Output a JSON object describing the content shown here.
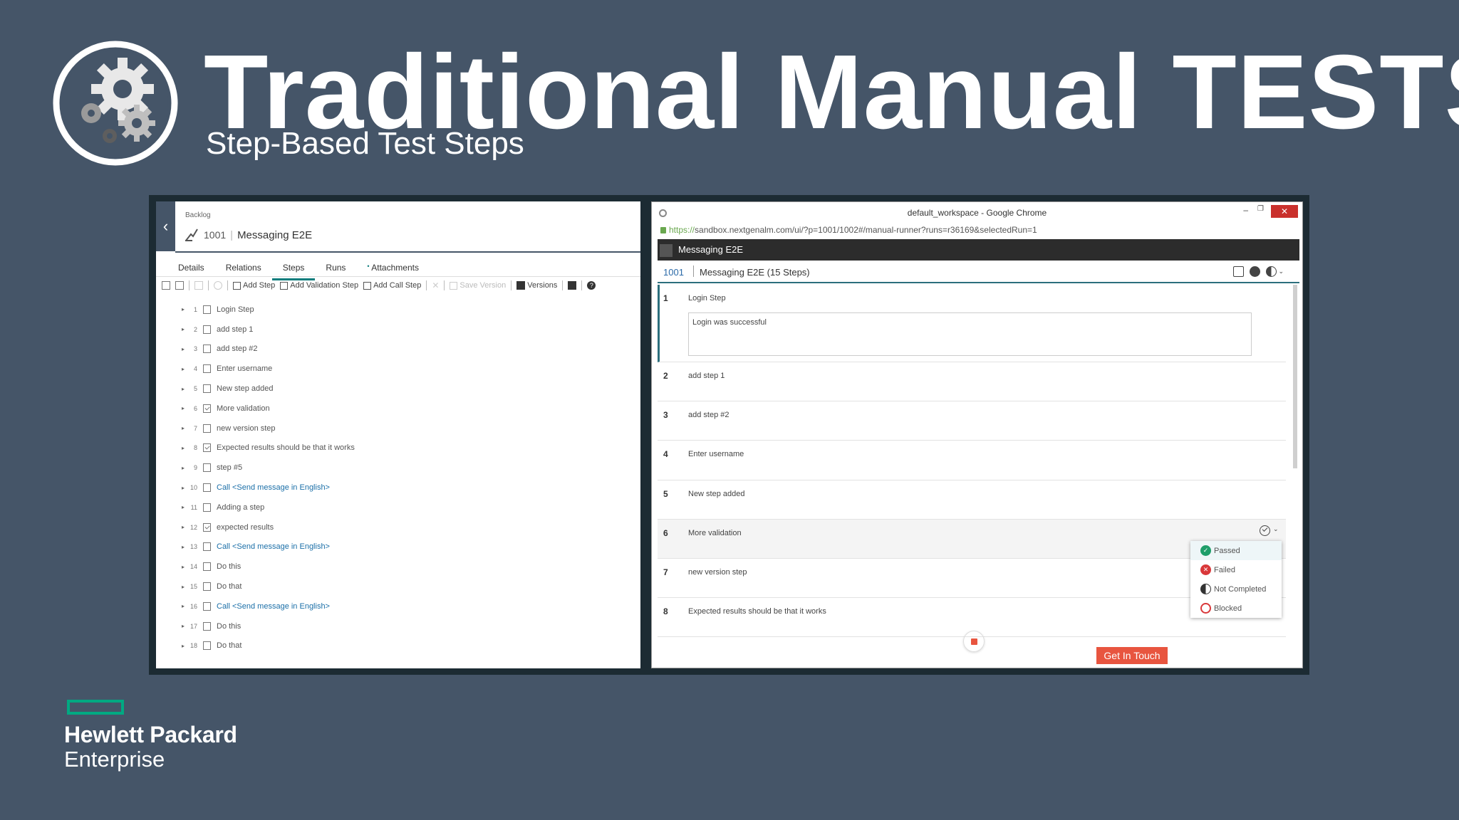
{
  "slide": {
    "title": "Traditional Manual TESTS",
    "subtitle": "Step-Based Test Steps",
    "logo_icon": "gears-icon"
  },
  "left_panel": {
    "breadcrumb": "Backlog",
    "entity_id": "1001",
    "entity_name": "Messaging E2E",
    "tabs": [
      {
        "label": "Details"
      },
      {
        "label": "Relations"
      },
      {
        "label": "Steps",
        "active": true
      },
      {
        "label": "Runs"
      },
      {
        "label": "Attachments",
        "dot": "•"
      }
    ],
    "toolbar": {
      "add_step": "Add Step",
      "add_validation_step": "Add Validation Step",
      "add_call_step": "Add Call Step",
      "save_version": "Save Version",
      "versions": "Versions",
      "help": "?"
    },
    "steps": [
      {
        "num": "1",
        "text": "Login Step",
        "type": "step"
      },
      {
        "num": "2",
        "text": "add step 1",
        "type": "step"
      },
      {
        "num": "3",
        "text": "add step #2",
        "type": "step"
      },
      {
        "num": "4",
        "text": "Enter username",
        "type": "step"
      },
      {
        "num": "5",
        "text": "New step added",
        "type": "step"
      },
      {
        "num": "6",
        "text": "More validation",
        "type": "validation"
      },
      {
        "num": "7",
        "text": "new version step",
        "type": "step"
      },
      {
        "num": "8",
        "text": "Expected results should be that it works",
        "type": "validation"
      },
      {
        "num": "9",
        "text": "step #5",
        "type": "step"
      },
      {
        "num": "10",
        "text": "Call <Send message in English>",
        "type": "call"
      },
      {
        "num": "11",
        "text": "Adding a step",
        "type": "step"
      },
      {
        "num": "12",
        "text": "expected results",
        "type": "validation"
      },
      {
        "num": "13",
        "text": "Call <Send message in English>",
        "type": "call"
      },
      {
        "num": "14",
        "text": "Do this",
        "type": "step"
      },
      {
        "num": "15",
        "text": "Do that",
        "type": "step"
      },
      {
        "num": "16",
        "text": "Call <Send message in English>",
        "type": "call"
      },
      {
        "num": "17",
        "text": "Do this",
        "type": "step"
      },
      {
        "num": "18",
        "text": "Do that",
        "type": "step"
      }
    ]
  },
  "right_panel": {
    "window_title": "default_workspace - Google Chrome",
    "window_controls": {
      "minimize": "–",
      "maximize": "❐",
      "close": "✕"
    },
    "url_scheme": "https://",
    "url_rest": "sandbox.nextgenalm.com/ui/?p=1001/1002#/manual-runner?runs=r36169&selectedRun=1",
    "run_title": "Messaging E2E",
    "run_id": "1001",
    "run_name": "Messaging E2E (15 Steps)",
    "steps": [
      {
        "num": "1",
        "text": "Login Step",
        "result": "Login was successful"
      },
      {
        "num": "2",
        "text": "add step 1"
      },
      {
        "num": "3",
        "text": "add step #2"
      },
      {
        "num": "4",
        "text": "Enter username"
      },
      {
        "num": "5",
        "text": "New step added"
      },
      {
        "num": "6",
        "text": "More validation"
      },
      {
        "num": "7",
        "text": "new version step"
      },
      {
        "num": "8",
        "text": "Expected results should be that it works"
      }
    ],
    "status_menu": [
      {
        "label": "Passed",
        "icon": "passed-icon",
        "color": "#1e9e6a"
      },
      {
        "label": "Failed",
        "icon": "failed-icon",
        "color": "#d9383a"
      },
      {
        "label": "Not Completed",
        "icon": "not-completed-icon",
        "color": "#333333"
      },
      {
        "label": "Blocked",
        "icon": "blocked-icon",
        "color": "#d9383a"
      }
    ],
    "get_in_touch": "Get In Touch"
  },
  "footer": {
    "brand_line1": "Hewlett Packard",
    "brand_line2": "Enterprise",
    "brand_color": "#01a982"
  },
  "colors": {
    "background": "#455568",
    "accent": "#2c6f7d",
    "link": "#1b6fa8",
    "cta": "#e8553f"
  }
}
